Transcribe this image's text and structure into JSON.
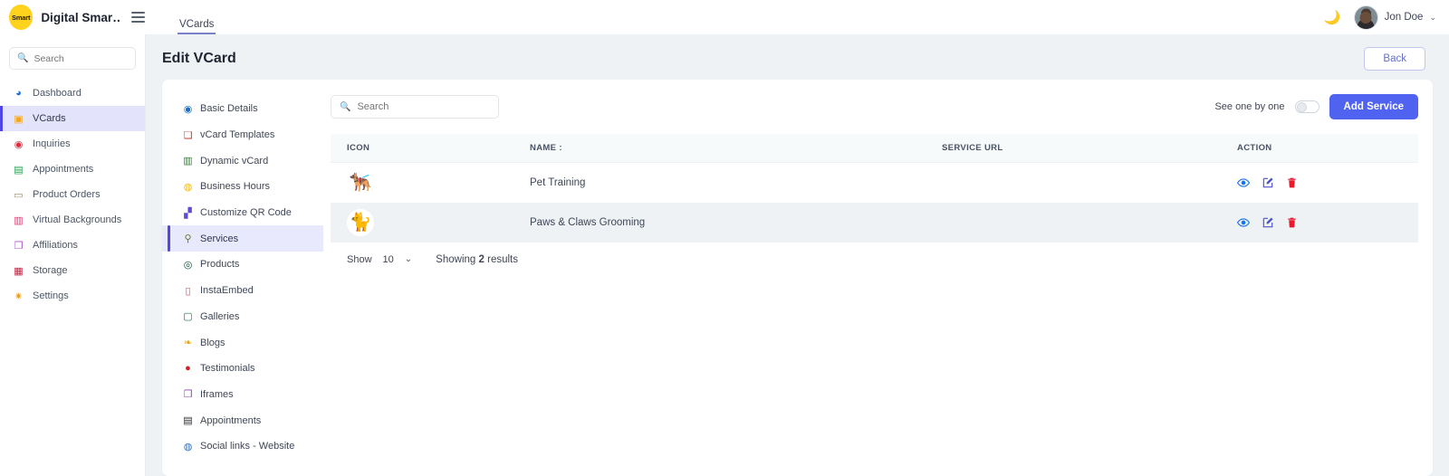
{
  "topbar": {
    "logo_text": "Smart",
    "brand_name": "Digital Smar…",
    "menu_icon": "hamburger-icon",
    "nav_tabs": [
      {
        "label": "VCards",
        "active": true
      }
    ],
    "theme_toggle_icon": "moon-icon",
    "user_name": "Jon Doe",
    "user_caret": "⌄"
  },
  "sidebar": {
    "search": {
      "placeholder": "Search",
      "value": "",
      "icon": "search-icon"
    },
    "items": [
      {
        "label": "Dashboard",
        "icon": "◕",
        "color": "#1e6fd9",
        "active": false
      },
      {
        "label": "VCards",
        "icon": "▣",
        "color": "#f5a623",
        "active": true
      },
      {
        "label": "Inquiries",
        "icon": "◉",
        "color": "#d92e3e",
        "active": false
      },
      {
        "label": "Appointments",
        "icon": "▤",
        "color": "#1f9d4d",
        "active": false
      },
      {
        "label": "Product Orders",
        "icon": "▭",
        "color": "#9a8c6b",
        "active": false
      },
      {
        "label": "Virtual Backgrounds",
        "icon": "▥",
        "color": "#e0366f",
        "active": false
      },
      {
        "label": "Affiliations",
        "icon": "❒",
        "color": "#a94fc4",
        "active": false
      },
      {
        "label": "Storage",
        "icon": "▦",
        "color": "#c02040",
        "active": false
      },
      {
        "label": "Settings",
        "icon": "✷",
        "color": "#f0a020",
        "active": false
      }
    ]
  },
  "page": {
    "title": "Edit VCard",
    "back_label": "Back"
  },
  "subnav": {
    "items": [
      {
        "label": "Basic Details",
        "icon": "◉",
        "color": "#1a6fc9",
        "active": false
      },
      {
        "label": "vCard Templates",
        "icon": "❏",
        "color": "#c0392b",
        "active": false
      },
      {
        "label": "Dynamic vCard",
        "icon": "▥",
        "color": "#2e7d32",
        "active": false
      },
      {
        "label": "Business Hours",
        "icon": "◍",
        "color": "#f2b90c",
        "active": false
      },
      {
        "label": "Customize QR Code",
        "icon": "▞",
        "color": "#5b4bd6",
        "active": false
      },
      {
        "label": "Services",
        "icon": "⚲",
        "color": "#6d7a1f",
        "active": true
      },
      {
        "label": "Products",
        "icon": "◎",
        "color": "#0f5132",
        "active": false
      },
      {
        "label": "InstaEmbed",
        "icon": "▯",
        "color": "#e4405f",
        "active": false
      },
      {
        "label": "Galleries",
        "icon": "▢",
        "color": "#1f7a3d",
        "active": false
      },
      {
        "label": "Blogs",
        "icon": "❧",
        "color": "#e6a817",
        "active": false
      },
      {
        "label": "Testimonials",
        "icon": "●",
        "color": "#d61f26",
        "active": false
      },
      {
        "label": "Iframes",
        "icon": "❐",
        "color": "#8e44ad",
        "active": false
      },
      {
        "label": "Appointments",
        "icon": "▤",
        "color": "#24292e",
        "active": false
      },
      {
        "label": "Social links - Website",
        "icon": "◍",
        "color": "#2f6fb5",
        "active": false
      }
    ]
  },
  "services_panel": {
    "search": {
      "placeholder": "Search",
      "value": "",
      "icon": "search-icon"
    },
    "toggle_label": "See one by one",
    "toggle_on": false,
    "add_button": "Add Service",
    "columns": [
      "ICON",
      "NAME :",
      "SERVICE URL",
      "ACTION"
    ],
    "rows": [
      {
        "icon_glyph": "🐕‍🦺",
        "icon_name": "pet-training-thumbnail",
        "name": "Pet Training",
        "service_url": "",
        "actions": [
          "view-icon",
          "edit-icon",
          "delete-icon"
        ]
      },
      {
        "icon_glyph": "🐈",
        "icon_name": "paws-claws-grooming-thumbnail",
        "name": "Paws & Claws Grooming",
        "service_url": "",
        "actions": [
          "view-icon",
          "edit-icon",
          "delete-icon"
        ]
      }
    ],
    "footer": {
      "show_label": "Show",
      "page_size": "10",
      "chevron": "⌄",
      "showing_prefix": "Showing",
      "result_count": "2",
      "showing_suffix": "results"
    }
  },
  "colors": {
    "accent": "#4f62f0",
    "active_nav_bg": "#e3e4fb",
    "active_nav_bar": "#4f46e5",
    "page_bg": "#eef2f5",
    "view_icon": "#1a73e8",
    "edit_icon": "#4a55c7",
    "delete_icon": "#e8192c",
    "logo_bg": "#ffd21e"
  }
}
